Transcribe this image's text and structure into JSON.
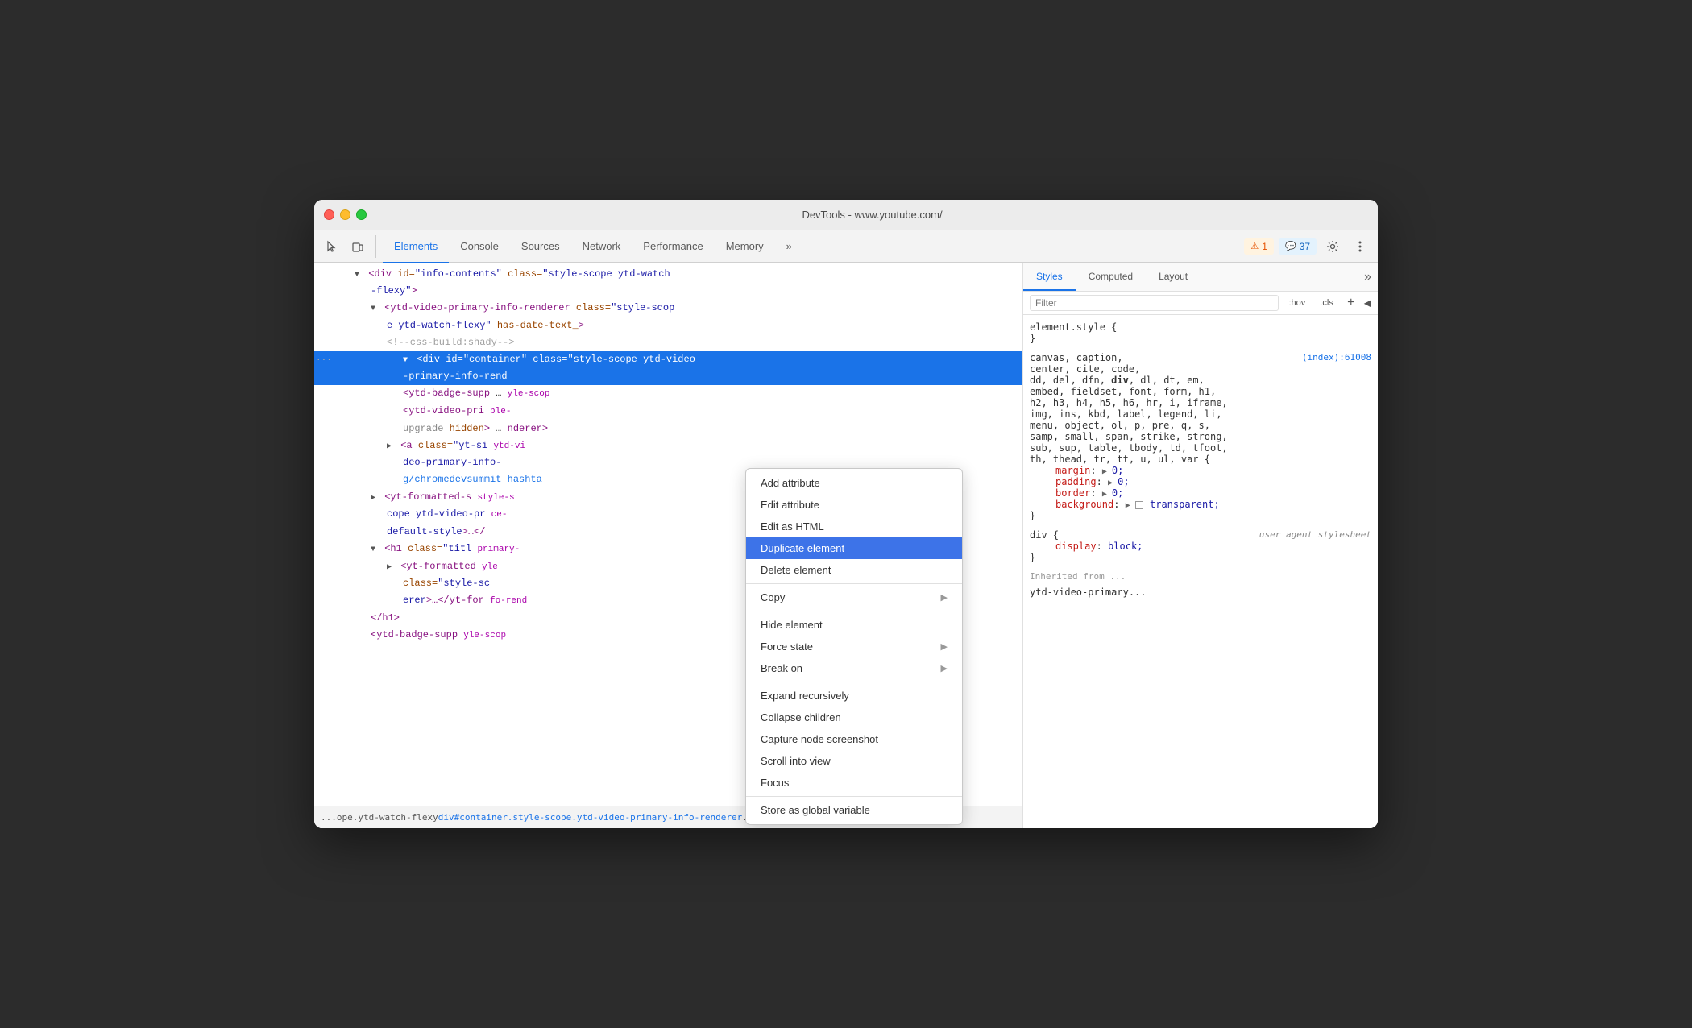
{
  "window": {
    "title": "DevTools - www.youtube.com/"
  },
  "toolbar": {
    "tabs": [
      {
        "label": "Elements",
        "active": true
      },
      {
        "label": "Console",
        "active": false
      },
      {
        "label": "Sources",
        "active": false
      },
      {
        "label": "Network",
        "active": false
      },
      {
        "label": "Performance",
        "active": false
      },
      {
        "label": "Memory",
        "active": false
      }
    ],
    "more_tabs": "»",
    "badge_warn_count": "1",
    "badge_info_count": "37"
  },
  "elements_panel": {
    "lines": [
      {
        "indent": "indent-2",
        "content": "▼ <div id=\"info-contents\" class=\"style-scope ytd-watch-flexy\">",
        "selected": false
      },
      {
        "indent": "indent-3",
        "content": "▼ <ytd-video-primary-info-renderer class=\"style-scope ytd-watch-flexy\" has-date-text_>",
        "selected": false
      },
      {
        "indent": "indent-4",
        "content": "<!--css-build:shady-->",
        "comment": true
      },
      {
        "indent": "indent-5",
        "content": "▼ <div id=\"container\" class=\"style-scope ytd-video-primary-info-rend",
        "selected": true
      },
      {
        "indent": "indent-5",
        "content": "-primary-info-rend"
      },
      {
        "indent": "indent-5",
        "content": "<ytd-badge-supp"
      },
      {
        "indent": "indent-5",
        "content": "<ytd-video-pri"
      },
      {
        "indent": "indent-5",
        "content": "upgrade hidden>"
      },
      {
        "indent": "indent-5",
        "content": "▶ <a class=\"yt-si"
      },
      {
        "indent": "indent-5",
        "content": "deo-primary-info-"
      },
      {
        "indent": "indent-5",
        "content": "g/chromedevsummit"
      },
      {
        "indent": "indent-4",
        "content": "▶ <yt-formatted-s"
      },
      {
        "indent": "indent-4",
        "content": "cope ytd-video-pr"
      },
      {
        "indent": "indent-4",
        "content": "default-style>…</"
      },
      {
        "indent": "indent-4",
        "content": "▼ <h1 class=\"titl"
      },
      {
        "indent": "indent-5",
        "content": "▶ <yt-formatted"
      },
      {
        "indent": "indent-5",
        "content": "class=\"style-sc"
      },
      {
        "indent": "indent-5",
        "content": "erer\">…</yt-for"
      },
      {
        "indent": "indent-4",
        "content": "</h1>"
      },
      {
        "indent": "indent-4",
        "content": "<ytd-badge-supp"
      }
    ],
    "context_menu": {
      "items": [
        {
          "label": "Add attribute",
          "has_submenu": false
        },
        {
          "label": "Edit attribute",
          "has_submenu": false
        },
        {
          "label": "Edit as HTML",
          "has_submenu": false
        },
        {
          "label": "Duplicate element",
          "highlighted": true,
          "has_submenu": false
        },
        {
          "label": "Delete element",
          "has_submenu": false
        },
        {
          "separator_after": true
        },
        {
          "label": "Copy",
          "has_submenu": true
        },
        {
          "separator_after": true
        },
        {
          "label": "Hide element",
          "has_submenu": false
        },
        {
          "label": "Force state",
          "has_submenu": true
        },
        {
          "label": "Break on",
          "has_submenu": true
        },
        {
          "separator_after": true
        },
        {
          "label": "Expand recursively",
          "has_submenu": false
        },
        {
          "label": "Collapse children",
          "has_submenu": false
        },
        {
          "label": "Capture node screenshot",
          "has_submenu": false
        },
        {
          "label": "Scroll into view",
          "has_submenu": false
        },
        {
          "label": "Focus",
          "has_submenu": false
        },
        {
          "separator_after": true
        },
        {
          "label": "Store as global variable",
          "has_submenu": false
        }
      ]
    },
    "status_bar": {
      "parts": [
        {
          "text": "...",
          "highlight": false
        },
        {
          "text": " ope.ytd-watch-flexy",
          "highlight": false
        },
        {
          "text": "  div#container.style-scope.ytd-video-primary-info-renderer",
          "highlight": true
        },
        {
          "text": " ...",
          "highlight": false
        }
      ]
    }
  },
  "styles_panel": {
    "tabs": [
      {
        "label": "Styles",
        "active": true
      },
      {
        "label": "Computed",
        "active": false
      },
      {
        "label": "Layout",
        "active": false
      }
    ],
    "filter_placeholder": "Filter",
    "filter_hov": ":hov",
    "filter_cls": ".cls",
    "rules": [
      {
        "selector": "element.style {",
        "close": "}",
        "source": "",
        "properties": []
      },
      {
        "selector": "canvas, caption,",
        "selector2": "center, cite, code,",
        "selector3": "dd, del, dfn, div, dl, dt, em,",
        "selector4": "embed, fieldset, font, form, h1,",
        "selector5": "h2, h3, h4, h5, h6, hr, i, iframe,",
        "selector6": "img, ins, kbd, label, legend, li,",
        "selector7": "menu, object, ol, p, pre, q, s,",
        "selector8": "samp, small, span, strike, strong,",
        "selector9": "sub, sup, table, tbody, td, tfoot,",
        "selector10": "th, thead, tr, tt, u, ul, var {",
        "source": "(index):61008",
        "properties": [
          {
            "name": "margin",
            "value": "▶ 0;"
          },
          {
            "name": "padding",
            "value": "▶ 0;"
          },
          {
            "name": "border",
            "value": "▶ 0;"
          },
          {
            "name": "background",
            "value": "▶ □transparent;"
          }
        ]
      },
      {
        "selector": "div {",
        "ua_comment": "user agent stylesheet",
        "properties": [
          {
            "name": "display",
            "value": "block;"
          }
        ],
        "close": "}"
      }
    ],
    "inherited_label": "Inherited from ...",
    "inherited_sub": "ytd-video-primary..."
  }
}
